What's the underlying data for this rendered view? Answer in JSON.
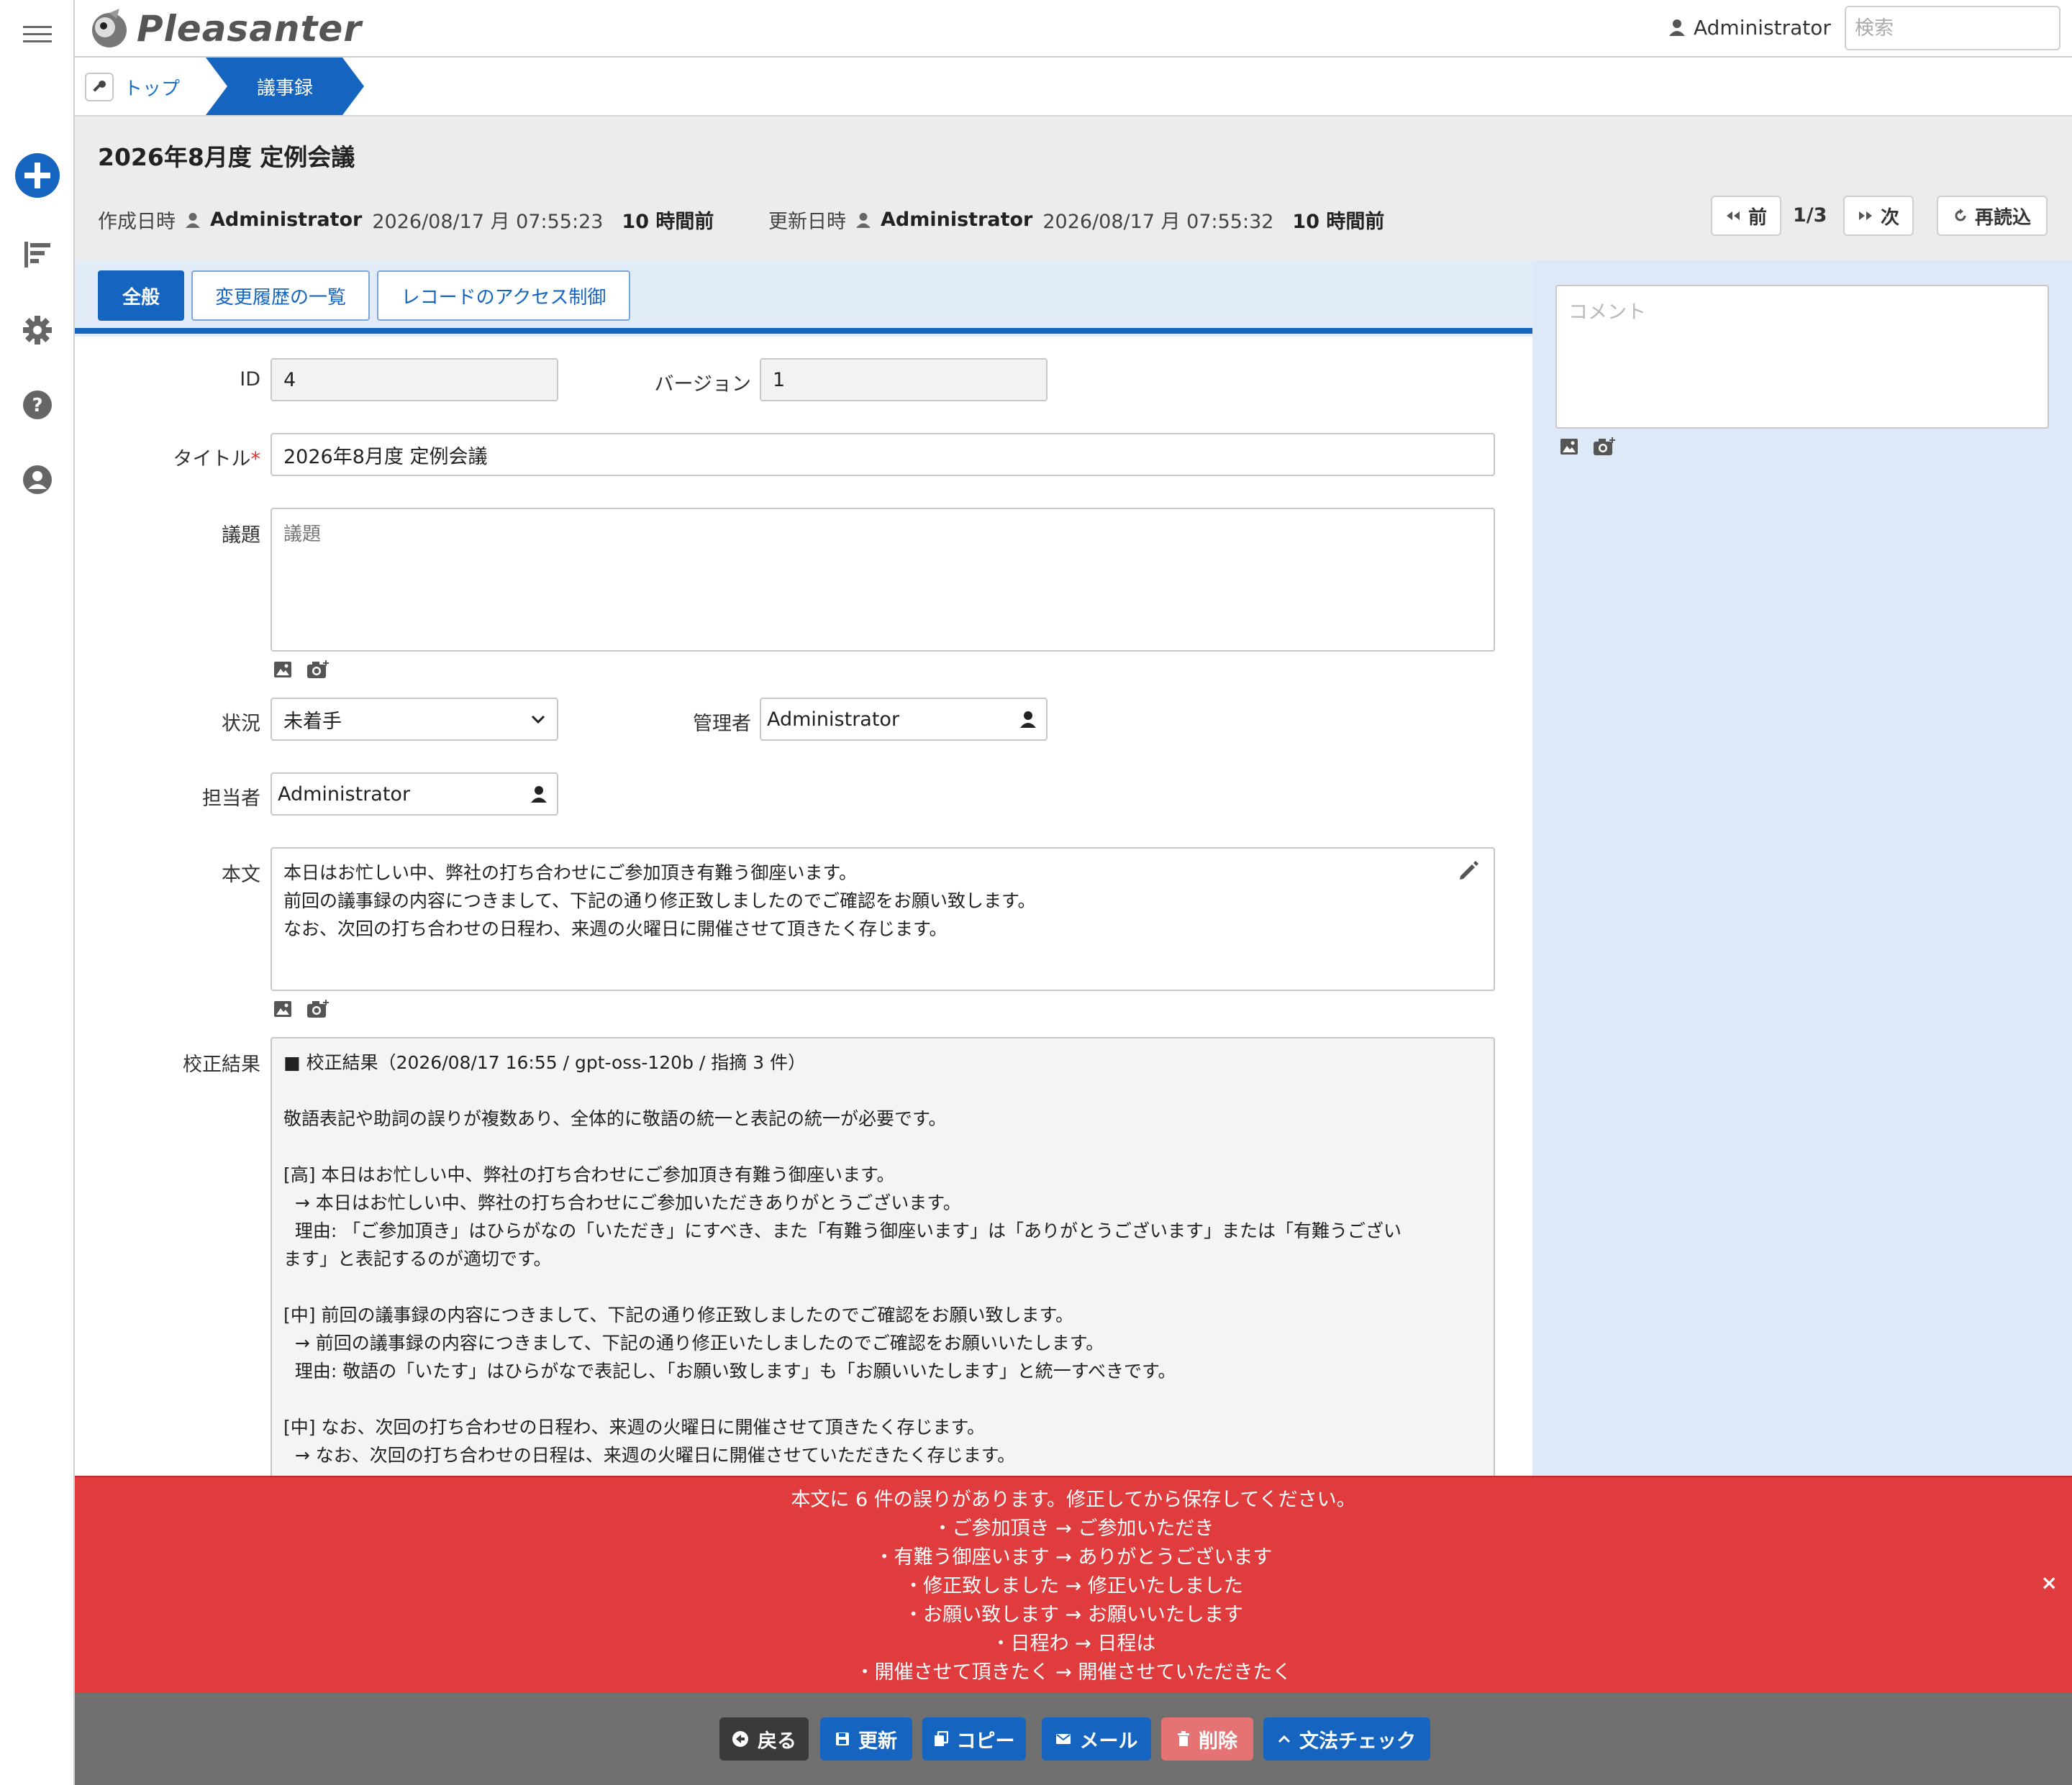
{
  "header": {
    "logo_text": "Pleasanter",
    "user_name": "Administrator",
    "search_placeholder": "検索"
  },
  "breadcrumb": {
    "top_label": "トップ",
    "current_label": "議事録"
  },
  "record": {
    "title": "2026年8月度 定例会議",
    "created_label": "作成日時",
    "created_by": "Administrator",
    "created_at": "2026/08/17 月 07:55:23",
    "created_ago": "10 時間前",
    "updated_label": "更新日時",
    "updated_by": "Administrator",
    "updated_at": "2026/08/17 月 07:55:32",
    "updated_ago": "10 時間前"
  },
  "pager": {
    "prev_label": "前",
    "count": "1/3",
    "next_label": "次",
    "reload_label": "再読込"
  },
  "tabs": [
    {
      "label": "全般",
      "active": true
    },
    {
      "label": "変更履歴の一覧",
      "active": false
    },
    {
      "label": "レコードのアクセス制御",
      "active": false
    }
  ],
  "comment": {
    "placeholder": "コメント"
  },
  "form": {
    "id_label": "ID",
    "id_value": "4",
    "version_label": "バージョン",
    "version_value": "1",
    "title_label": "タイトル",
    "title_required": "*",
    "title_value": "2026年8月度 定例会議",
    "agenda_label": "議題",
    "agenda_placeholder": "議題",
    "status_label": "状況",
    "status_value": "未着手",
    "manager_label": "管理者",
    "manager_value": "Administrator",
    "owner_label": "担当者",
    "owner_value": "Administrator",
    "body_label": "本文",
    "body_text": "本日はお忙しい中、弊社の打ち合わせにご参加頂き有難う御座います。\n前回の議事録の内容につきまして、下記の通り修正致しましたのでご確認をお願い致します。\nなお、次回の打ち合わせの日程わ、来週の火曜日に開催させて頂きたく存じます。",
    "review_label": "校正結果",
    "review_text": "■ 校正結果（2026/08/17 16:55 / gpt-oss-120b / 指摘 3 件）\n\n敬語表記や助詞の誤りが複数あり、全体的に敬語の統一と表記の統一が必要です。\n\n[高] 本日はお忙しい中、弊社の打ち合わせにご参加頂き有難う御座います。\n  → 本日はお忙しい中、弊社の打ち合わせにご参加いただきありがとうございます。\n  理由: 「ご参加頂き」はひらがなの「いただき」にすべき、また「有難う御座います」は「ありがとうございます」または「有難うござい\nます」と表記するのが適切です。\n\n[中] 前回の議事録の内容につきまして、下記の通り修正致しましたのでご確認をお願い致します。\n  → 前回の議事録の内容につきまして、下記の通り修正いたしましたのでご確認をお願いいたします。\n  理由: 敬語の「いたす」はひらがなで表記し、「お願い致します」も「お願いいたします」と統一すべきです。\n\n[中] なお、次回の打ち合わせの日程わ、来週の火曜日に開催させて頂きたく存じます。\n  → なお、次回の打ち合わせの日程は、来週の火曜日に開催させていただきたく存じます。"
  },
  "alert": {
    "lines": [
      "本文に 6 件の誤りがあります。修正してから保存してください。",
      "・ご参加頂き → ご参加いただき",
      "・有難う御座います → ありがとうございます",
      "・修正致しました → 修正いたしました",
      "・お願い致します → お願いいたします",
      "・日程わ → 日程は",
      "・開催させて頂きたく → 開催させていただきたく"
    ],
    "close": "×"
  },
  "footer": {
    "back_label": "戻る",
    "update_label": "更新",
    "copy_label": "コピー",
    "mail_label": "メール",
    "delete_label": "削除",
    "grammar_label": "文法チェック"
  },
  "colors": {
    "primary": "#1565c0",
    "alert": "#e03b3d",
    "delete": "#e57373",
    "back": "#3a3a3a",
    "footer_bg": "#707070"
  }
}
